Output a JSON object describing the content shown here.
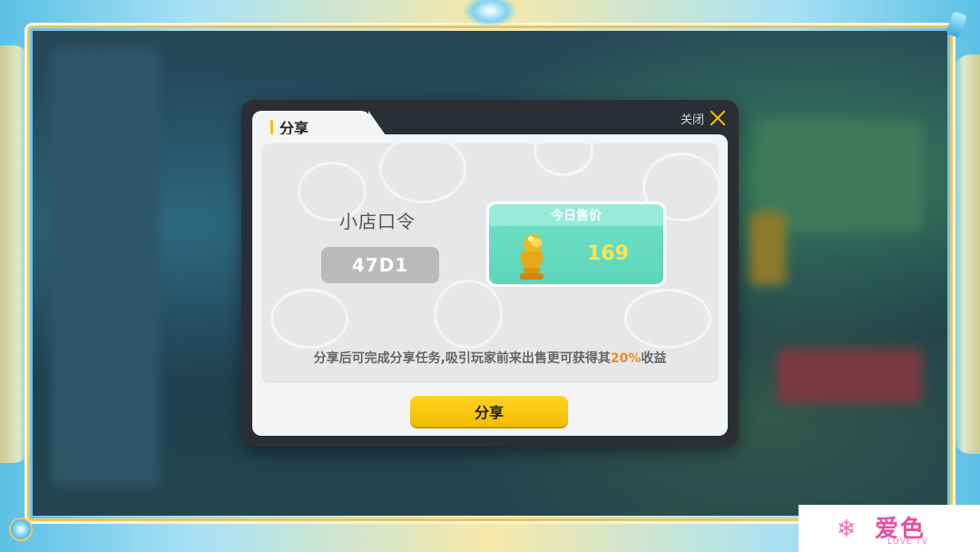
{
  "dialog": {
    "tab_label": "分享",
    "close_label": "关闭",
    "shop_code_title": "小店口令",
    "shop_code_value": "47D1",
    "price_card": {
      "header": "今日售价",
      "price": "169"
    },
    "description": {
      "before": "分享后可完成分享任务,吸引玩家前来出售更可获得其",
      "highlight": "20%",
      "after": "收益"
    },
    "share_button_label": "分享"
  },
  "watermark": {
    "logo_text": "爱色",
    "sub_text": "LOVE TV"
  },
  "colors": {
    "accent_yellow": "#f5c400",
    "price_green": "#5ed6bb",
    "highlight_orange": "#f08a1c"
  },
  "icons": [
    "close-icon",
    "trophy-icon",
    "snowflake-icon"
  ]
}
